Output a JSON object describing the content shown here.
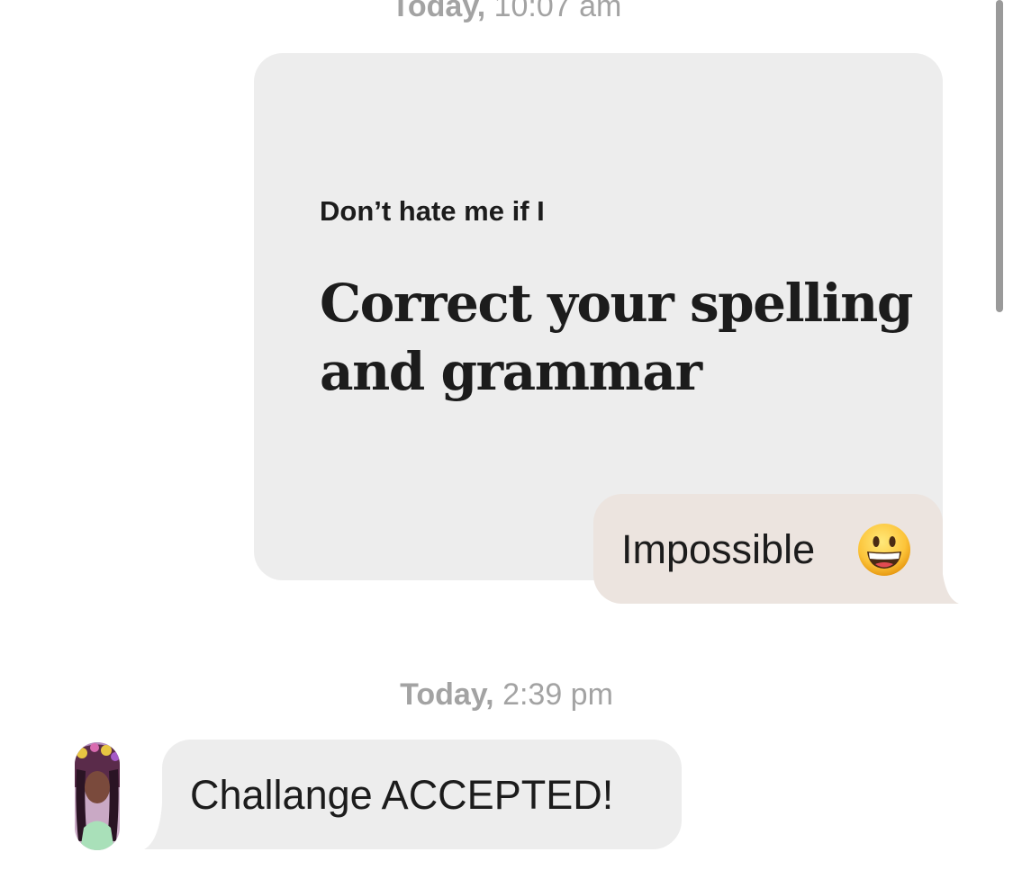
{
  "timestamps": [
    {
      "day": "Today,",
      "time": "10:07 am"
    },
    {
      "day": "Today,",
      "time": "2:39 pm"
    }
  ],
  "prompt_card": {
    "label": "Don’t hate me if I",
    "answer": "Correct your spelling and grammar"
  },
  "reply": {
    "text": "Impossible",
    "emoji": "grinning-face-emoji"
  },
  "incoming_message": {
    "text": "Challange ACCEPTED!"
  },
  "colors": {
    "card_background": "#ededed",
    "sent_bubble": "#ece4df",
    "received_bubble": "#ededed",
    "timestamp_text": "#a3a3a3",
    "text": "#1c1c1c"
  }
}
